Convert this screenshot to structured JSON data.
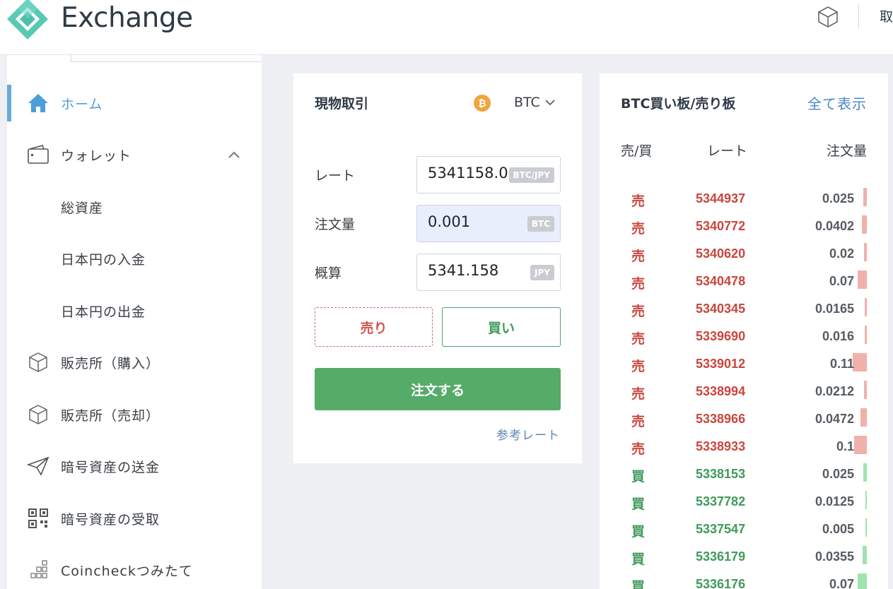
{
  "header": {
    "brand": "Exchange",
    "right_cut_text": "取"
  },
  "sidebar": {
    "items": [
      {
        "label": "ホーム",
        "icon": "home-icon",
        "active": true
      },
      {
        "label": "ウォレット",
        "icon": "wallet-icon",
        "expanded": true
      },
      {
        "label": "総資産",
        "icon": ""
      },
      {
        "label": "日本円の入金",
        "icon": ""
      },
      {
        "label": "日本円の出金",
        "icon": ""
      },
      {
        "label": "販売所（購入）",
        "icon": "box-icon"
      },
      {
        "label": "販売所（売却）",
        "icon": "box-icon"
      },
      {
        "label": "暗号資産の送金",
        "icon": "send-icon"
      },
      {
        "label": "暗号資産の受取",
        "icon": "qr-icon"
      },
      {
        "label": "Coincheckつみたて",
        "icon": "dots-grid-icon"
      }
    ]
  },
  "trade": {
    "title": "現物取引",
    "coin_symbol": "₿",
    "coin": "BTC",
    "rate_label": "レート",
    "rate_value": "5341158.0",
    "rate_unit": "BTC/JPY",
    "amount_label": "注文量",
    "amount_value": "0.001",
    "amount_unit": "BTC",
    "estimate_label": "概算",
    "estimate_value": "5341.158",
    "estimate_unit": "JPY",
    "sell": "売り",
    "buy": "買い",
    "order": "注文する",
    "ref_rate": "参考レート"
  },
  "book": {
    "title": "BTC買い板/売り板",
    "show_all": "全て表示",
    "col_side": "売/買",
    "col_rate": "レート",
    "col_amount": "注文量",
    "rows": [
      {
        "side": "売",
        "type": "ask",
        "rate": "5344937",
        "amount": "0.025",
        "depth": 0.025
      },
      {
        "side": "売",
        "type": "ask",
        "rate": "5340772",
        "amount": "0.0402",
        "depth": 0.0402
      },
      {
        "side": "売",
        "type": "ask",
        "rate": "5340620",
        "amount": "0.02",
        "depth": 0.02
      },
      {
        "side": "売",
        "type": "ask",
        "rate": "5340478",
        "amount": "0.07",
        "depth": 0.07
      },
      {
        "side": "売",
        "type": "ask",
        "rate": "5340345",
        "amount": "0.0165",
        "depth": 0.0165
      },
      {
        "side": "売",
        "type": "ask",
        "rate": "5339690",
        "amount": "0.016",
        "depth": 0.016
      },
      {
        "side": "売",
        "type": "ask",
        "rate": "5339012",
        "amount": "0.11",
        "depth": 0.11
      },
      {
        "side": "売",
        "type": "ask",
        "rate": "5338994",
        "amount": "0.0212",
        "depth": 0.0212
      },
      {
        "side": "売",
        "type": "ask",
        "rate": "5338966",
        "amount": "0.0472",
        "depth": 0.0472
      },
      {
        "side": "売",
        "type": "ask",
        "rate": "5338933",
        "amount": "0.1",
        "depth": 0.1
      },
      {
        "side": "買",
        "type": "bid",
        "rate": "5338153",
        "amount": "0.025",
        "depth": 0.025
      },
      {
        "side": "買",
        "type": "bid",
        "rate": "5337782",
        "amount": "0.0125",
        "depth": 0.0125
      },
      {
        "side": "買",
        "type": "bid",
        "rate": "5337547",
        "amount": "0.005",
        "depth": 0.005
      },
      {
        "side": "買",
        "type": "bid",
        "rate": "5336179",
        "amount": "0.0355",
        "depth": 0.0355
      },
      {
        "side": "買",
        "type": "bid",
        "rate": "5336176",
        "amount": "0.07",
        "depth": 0.07
      }
    ]
  },
  "colors": {
    "accent": "#4b9fd8",
    "sell": "#c9463d",
    "buy": "#3f9a5b",
    "order_button": "#55ab68"
  }
}
